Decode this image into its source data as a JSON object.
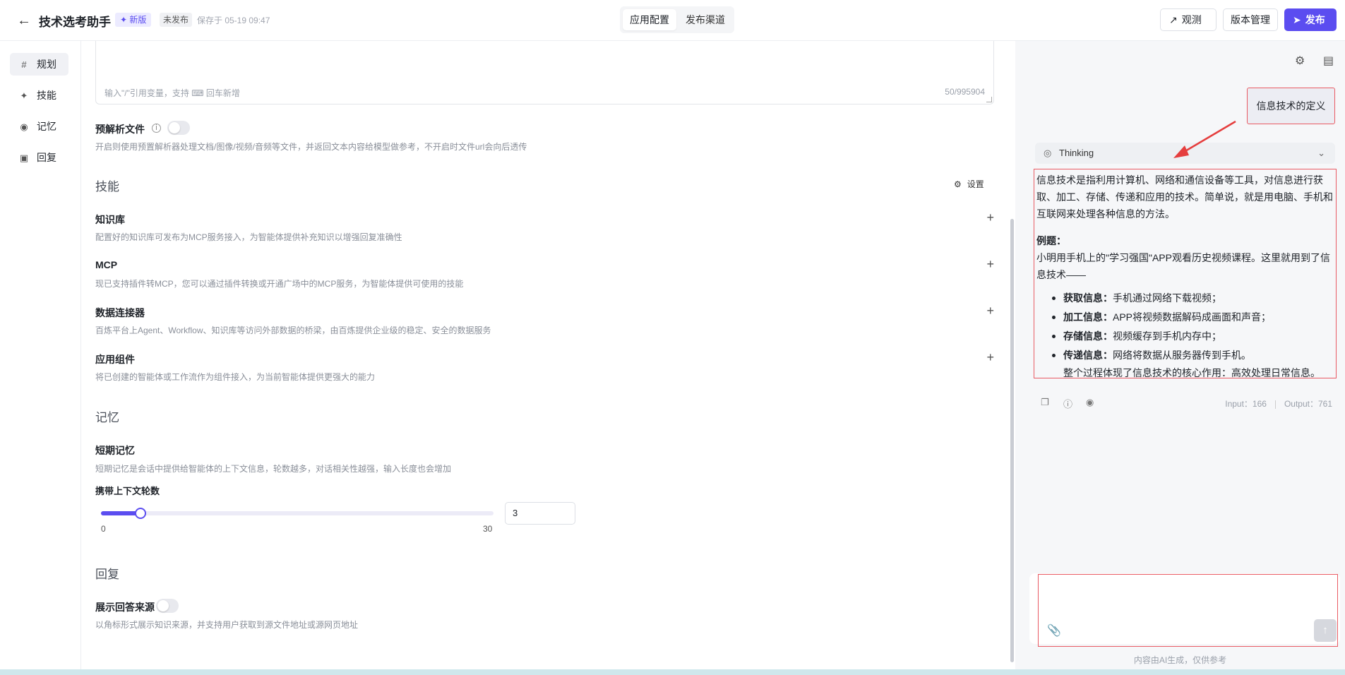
{
  "header": {
    "back_icon": "arrow-left-icon",
    "title": "技术选考助手",
    "badge_new": "✦ 新版",
    "badge_unpublished": "未发布",
    "saved_text": "保存于 05-19 09:47",
    "tabs": [
      {
        "label": "应用配置",
        "active": true
      },
      {
        "label": "发布渠道",
        "active": false
      }
    ],
    "observe_label": "观测",
    "version_label": "版本管理",
    "publish_label": "发布"
  },
  "leftnav": {
    "items": [
      {
        "label": "规划",
        "icon": "hash-icon",
        "active": true
      },
      {
        "label": "技能",
        "icon": "magic-icon",
        "active": false
      },
      {
        "label": "记忆",
        "icon": "brain-icon",
        "active": false
      },
      {
        "label": "回复",
        "icon": "reply-icon",
        "active": false
      }
    ]
  },
  "main": {
    "prompt_hint": "输入\"/\"引用变量，支持",
    "prompt_hint_tail": "回车新增",
    "prompt_count": "50/995904",
    "preparse": {
      "label": "预解析文件",
      "enabled": false,
      "desc": "开启则使用预置解析器处理文档/图像/视频/音频等文件，并返回文本内容给模型做参考，不开启时文件url会向后透传"
    },
    "skills": {
      "title": "技能",
      "settings_label": "设置",
      "items": [
        {
          "label": "知识库",
          "desc": "配置好的知识库可发布为MCP服务接入，为智能体提供补充知识以增强回复准确性"
        },
        {
          "label": "MCP",
          "desc": "现已支持插件转MCP，您可以通过插件转换或开通广场中的MCP服务，为智能体提供可使用的技能"
        },
        {
          "label": "数据连接器",
          "desc": "百炼平台上Agent、Workflow、知识库等访问外部数据的桥梁，由百炼提供企业级的稳定、安全的数据服务"
        },
        {
          "label": "应用组件",
          "desc": "将已创建的智能体或工作流作为组件接入，为当前智能体提供更强大的能力"
        }
      ]
    },
    "memory": {
      "title": "记忆",
      "short_label": "短期记忆",
      "short_desc": "短期记忆是会话中提供给智能体的上下文信息，轮数越多，对话相关性越强，输入长度也会增加",
      "rounds_label": "携带上下文轮数",
      "slider_min": "0",
      "slider_max": "30",
      "slider_value": 3,
      "rounds_value": "3"
    },
    "reply": {
      "title": "回复",
      "source_label": "展示回答来源",
      "source_enabled": false,
      "source_desc": "以角标形式展示知识来源，并支持用户获取到源文件地址或源网页地址"
    }
  },
  "chat": {
    "settings_icon": "gear-icon",
    "clear_icon": "broom-icon",
    "user_message": "信息技术的定义",
    "thinking_label": "Thinking",
    "answer_intro": "信息技术是指利用计算机、网络和通信设备等工具，对信息进行获取、加工、存储、传递和应用的技术。简单说，就是用电脑、手机和互联网来处理各种信息的方法。",
    "example_title": "例题：",
    "example_text": "小明用手机上的\"学习强国\"APP观看历史视频课程。这里就用到了信息技术——",
    "bullets": [
      {
        "bold": "获取信息：",
        "text": "手机通过网络下载视频；"
      },
      {
        "bold": "加工信息：",
        "text": "APP将视频数据解码成画面和声音；"
      },
      {
        "bold": "存储信息：",
        "text": "视频缓存到手机内存中；"
      },
      {
        "bold": "传递信息：",
        "text": "网络将数据从服务器传到手机。"
      }
    ],
    "summary": "整个过程体现了信息技术的核心作用：高效处理日常信息。",
    "input_tokens": "Input：166",
    "output_tokens": "Output：761",
    "disclaimer": "内容由AI生成，仅供参考"
  }
}
